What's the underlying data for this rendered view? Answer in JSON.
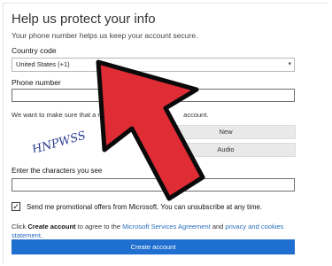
{
  "form": {
    "title": "Help us protect your info",
    "subtitle": "Your phone number helps us keep your account secure.",
    "country_label": "Country code",
    "country_value": "United States (+1)",
    "phone_label": "Phone number",
    "phone_value": "",
    "note_text": "We want to make sure that a real p",
    "note_tail": "account.",
    "new_button": "New",
    "audio_button": "Audio",
    "captcha_text": "HNPWSS",
    "captcha_label": "Enter the characters you see",
    "captcha_value": "",
    "promo_checked": "✓",
    "promo_text": "Send me promotional offers from Microsoft. You can unsubscribe at any time.",
    "agree_prefix": "Click",
    "agree_bold": "Create account",
    "agree_mid": "to agree to the",
    "agree_link1": "Microsoft Services Agreement",
    "agree_and": "and",
    "agree_link2": "privacy and cookies statement",
    "agree_end": ".",
    "create_button": "Create account"
  },
  "colors": {
    "primary_button": "#1f6fd0",
    "link": "#2a6ebb",
    "arrow": "#e02c35"
  }
}
